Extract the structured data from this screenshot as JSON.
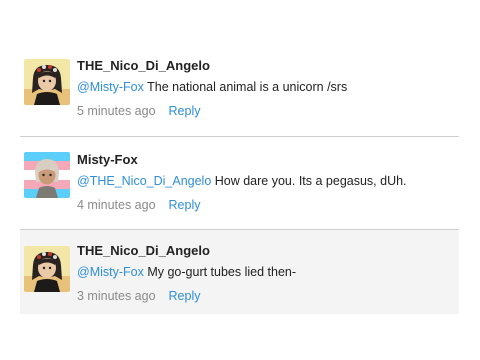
{
  "comments": [
    {
      "author": "THE_Nico_Di_Angelo",
      "mention": "@Misty-Fox",
      "text": " The national animal is a unicorn /srs",
      "time": "5 minutes ago",
      "reply_label": "Reply",
      "avatar_icon": "anime-character-avatar"
    },
    {
      "author": "Misty-Fox",
      "mention": "@THE_Nico_Di_Angelo",
      "text": " How dare you. Its a pegasus, dUh.",
      "time": "4 minutes ago",
      "reply_label": "Reply",
      "avatar_icon": "anime-character-avatar"
    },
    {
      "author": "THE_Nico_Di_Angelo",
      "mention": "@Misty-Fox",
      "text": " My go-gurt tubes lied then-",
      "time": "3 minutes ago",
      "reply_label": "Reply",
      "avatar_icon": "anime-character-avatar"
    }
  ],
  "colors": {
    "link": "#2f8fd8",
    "text": "#222222",
    "muted": "#8a8a8a",
    "divider": "#cfcfcf",
    "highlight_bg": "#f4f4f4"
  }
}
